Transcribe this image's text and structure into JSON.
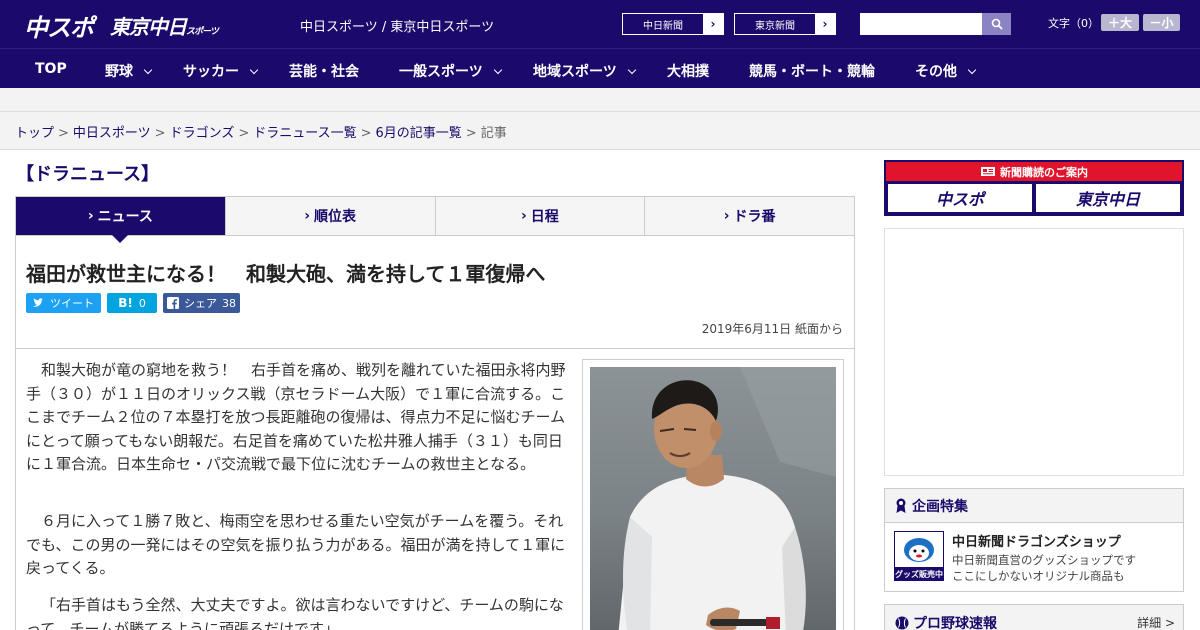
{
  "header": {
    "logo_main": "中スポ",
    "logo_tokyo": "東京中日",
    "logo_tokyo_small": "スポーツ",
    "tagline": "中日スポーツ / 東京中日スポーツ",
    "newspaper_buttons": [
      "中日新聞",
      "東京新聞"
    ],
    "search_placeholder": "",
    "font_size_label": "文字（0）",
    "font_bigger": "＋大",
    "font_smaller": "－小"
  },
  "nav": {
    "items": [
      {
        "label": "TOP",
        "has_menu": false
      },
      {
        "label": "野球",
        "has_menu": true
      },
      {
        "label": "サッカー",
        "has_menu": true
      },
      {
        "label": "芸能・社会",
        "has_menu": false
      },
      {
        "label": "一般スポーツ",
        "has_menu": true
      },
      {
        "label": "地域スポーツ",
        "has_menu": true
      },
      {
        "label": "大相撲",
        "has_menu": false
      },
      {
        "label": "競馬・ボート・競輪",
        "has_menu": false
      },
      {
        "label": "その他",
        "has_menu": true
      }
    ]
  },
  "breadcrumb": {
    "links": [
      "トップ",
      "中日スポーツ",
      "ドラゴンズ",
      "ドラニュース一覧",
      "6月の記事一覧"
    ],
    "current": "記事"
  },
  "section": {
    "title": "【ドラニュース】"
  },
  "tabs": [
    {
      "label": "ニュース",
      "active": true
    },
    {
      "label": "順位表",
      "active": false
    },
    {
      "label": "日程",
      "active": false
    },
    {
      "label": "ドラ番",
      "active": false
    }
  ],
  "article": {
    "headline": "福田が救世主になる！　和製大砲、満を持して１軍復帰へ",
    "share": {
      "tweet": "ツイート",
      "hatena_mark": "B!",
      "hatena_count": "0",
      "facebook_label": "シェア",
      "facebook_count": "38"
    },
    "dateline": "2019年6月11日 紙面から",
    "paragraphs": [
      "和製大砲が竜の窮地を救う！　右手首を痛め、戦列を離れていた福田永将内野手（３０）が１１日のオリックス戦（京セラドーム大阪）で１軍に合流する。ここまでチーム２位の７本塁打を放つ長距離砲の復帰は、得点力不足に悩むチームにとって願ってもない朗報だ。右足首を痛めていた松井雅人捕手（３１）も同日に１軍合流。日本生命セ・パ交流戦で最下位に沈むチームの救世主となる。",
      "６月に入って１勝７敗と、梅雨空を思わせる重たい空気がチームを覆う。それでも、この男の一発にはその空気を振り払う力がある。福田が満を持して１軍に戻ってくる。",
      "「右手首はもう全然、大丈夫ですよ。欲は言わないですけど、チームの駒になって、チームが勝てるように頑張るだけです」"
    ]
  },
  "sidebar": {
    "subscription_label": "新聞購読のご案内",
    "subscription_papers": [
      "中スポ",
      "東京中日"
    ],
    "feature_title": "企画特集",
    "shop_title": "中日新聞ドラゴンズショップ",
    "shop_desc_1": "中日新聞直営のグッズショップです",
    "shop_desc_2": "ここにしかないオリジナル商品も",
    "shop_badge": "グッズ販売中",
    "live_title": "プロ野球速報",
    "live_more": "詳細 >"
  },
  "colors": {
    "brand_navy": "#1b0a6b",
    "subscription_red": "#e0152c",
    "twitter_blue": "#1da1f2",
    "hatena_blue": "#00a4de",
    "facebook_blue": "#3b5998"
  }
}
